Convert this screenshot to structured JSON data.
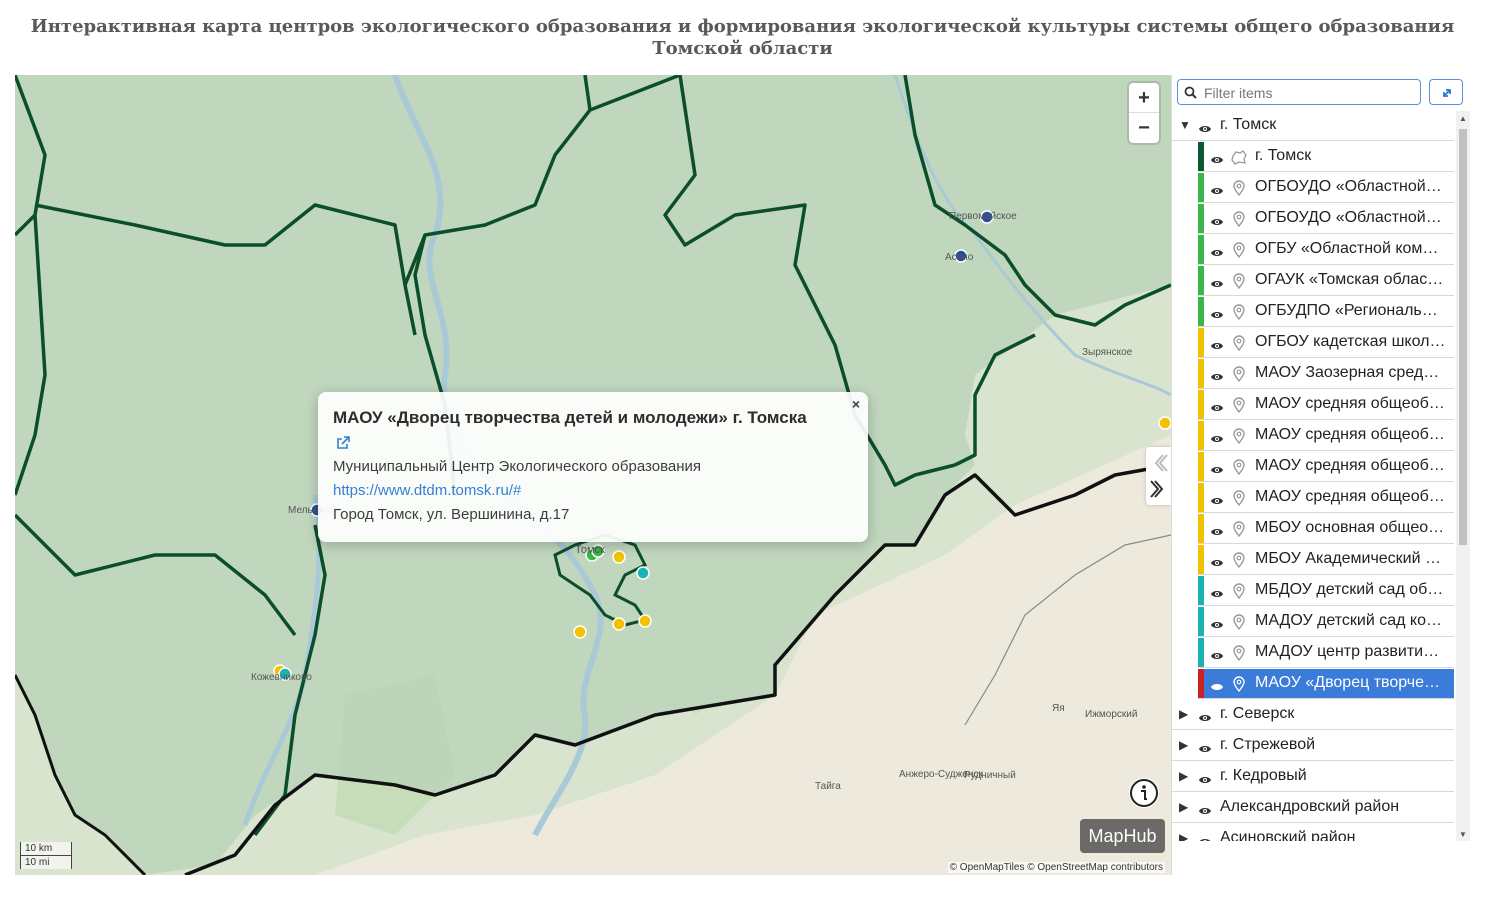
{
  "title": "Интерактивная карта центров экологического образования и формирования экологической культуры системы общего образования Томской области",
  "map": {
    "zoom_in": "+",
    "zoom_out": "−",
    "places": [
      {
        "name": "Первомайское"
      },
      {
        "name": "Асино"
      },
      {
        "name": "Зырянское"
      },
      {
        "name": "Мельниково"
      },
      {
        "name": "Кожевниково"
      },
      {
        "name": "Томск"
      },
      {
        "name": "Ижморский"
      },
      {
        "name": "Яя"
      },
      {
        "name": "Анжеро-Судженск"
      },
      {
        "name": "Рудничный"
      },
      {
        "name": "Тайга"
      }
    ],
    "popup": {
      "title": "МАОУ «Дворец творчества детей и молодежи» г. Томска",
      "description": "Муниципальный Центр Экологического образования",
      "url": "https://www.dtdm.tomsk.ru/#",
      "address": "Город Томск, ул. Вершинина, д.17",
      "close": "×"
    },
    "brand": "MapHub",
    "attribution": "© OpenMapTiles © OpenStreetMap contributors",
    "scale_km": "10 km",
    "scale_mi": "10 mi",
    "colors": {
      "border": "#0b4f2a",
      "region_fill": "#b9d3b9",
      "land": "#ede9dc"
    }
  },
  "panel": {
    "filter_placeholder": "Filter items",
    "rows": [
      {
        "label": "г. Томск",
        "type": "group-open",
        "color": ""
      },
      {
        "label": "г. Томск",
        "type": "area",
        "color": "#0b5a33"
      },
      {
        "label": "ОГБОУДО «Областной…",
        "type": "point",
        "color": "#3cb54a"
      },
      {
        "label": "ОГБОУДО «Областной…",
        "type": "point",
        "color": "#3cb54a"
      },
      {
        "label": "ОГБУ «Областной ком…",
        "type": "point",
        "color": "#3cb54a"
      },
      {
        "label": "ОГАУК «Томская облас…",
        "type": "point",
        "color": "#3cb54a"
      },
      {
        "label": "ОГБУДПО «Региональ…",
        "type": "point",
        "color": "#3cb54a"
      },
      {
        "label": "ОГБОУ кадетская школ…",
        "type": "point",
        "color": "#f2c200"
      },
      {
        "label": "МАОУ Заозерная сред…",
        "type": "point",
        "color": "#f2c200"
      },
      {
        "label": "МАОУ средняя общеоб…",
        "type": "point",
        "color": "#f2c200"
      },
      {
        "label": "МАОУ средняя общеоб…",
        "type": "point",
        "color": "#f2c200"
      },
      {
        "label": "МАОУ средняя общеоб…",
        "type": "point",
        "color": "#f2c200"
      },
      {
        "label": "МАОУ средняя общеоб…",
        "type": "point",
        "color": "#f2c200"
      },
      {
        "label": "МБОУ основная общео…",
        "type": "point",
        "color": "#f2c200"
      },
      {
        "label": "МБОУ Академический …",
        "type": "point",
        "color": "#f2c200"
      },
      {
        "label": "МБДОУ детский сад об…",
        "type": "point",
        "color": "#19b3b3"
      },
      {
        "label": "МАДОУ детский сад ко…",
        "type": "point",
        "color": "#19b3b3"
      },
      {
        "label": "МАДОУ центр развити…",
        "type": "point",
        "color": "#19b3b3"
      },
      {
        "label": "МАОУ «Дворец творче…",
        "type": "point-selected",
        "color": "#cc2222"
      },
      {
        "label": "г. Северск",
        "type": "group",
        "color": ""
      },
      {
        "label": "г. Стрежевой",
        "type": "group",
        "color": ""
      },
      {
        "label": "г. Кедровый",
        "type": "group",
        "color": ""
      },
      {
        "label": "Александровский район",
        "type": "group",
        "color": ""
      },
      {
        "label": "Асиновский район",
        "type": "group",
        "color": ""
      }
    ]
  }
}
